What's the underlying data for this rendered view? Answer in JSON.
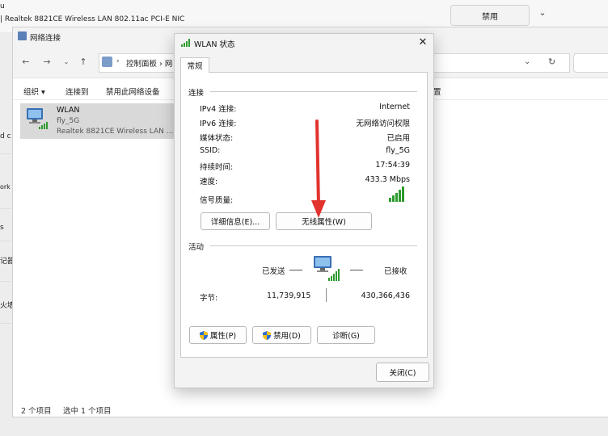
{
  "background": {
    "title_fragment": "u",
    "adapter_desc": "| Realtek 8821CE Wireless LAN 802.11ac PCI-E NIC",
    "disable_button": "禁用",
    "left_fragments": [
      "d c",
      "ork a",
      "s",
      "记器",
      "火墙"
    ]
  },
  "explorer": {
    "title": "网络连接",
    "address": {
      "separator": "›",
      "path1": "控制面板",
      "path2_fragment": "网"
    },
    "commands": {
      "organize": "组织 ▾",
      "connect_to": "连接到",
      "disable_device": "禁用此网络设备",
      "right_fragment": "置"
    },
    "item": {
      "name": "WLAN",
      "ssid": "fly_5G",
      "description": "Realtek 8821CE Wireless LAN ..."
    },
    "status": {
      "count": "2 个项目",
      "selected": "选中 1 个项目"
    }
  },
  "dialog": {
    "title": "WLAN 状态",
    "tab": "常规",
    "connection_group": "连接",
    "rows": [
      {
        "label": "IPv4 连接:",
        "value": "Internet"
      },
      {
        "label": "IPv6 连接:",
        "value": "无网络访问权限"
      },
      {
        "label": "媒体状态:",
        "value": "已启用"
      },
      {
        "label": "SSID:",
        "value": "fly_5G"
      },
      {
        "label": "持续时间:",
        "value": "17:54:39"
      },
      {
        "label": "速度:",
        "value": "433.3 Mbps"
      }
    ],
    "signal_label": "信号质量:",
    "details_button": "详细信息(E)...",
    "wireless_props_button": "无线属性(W)",
    "activity_group": "活动",
    "sent_label": "已发送",
    "received_label": "已接收",
    "bytes_label": "字节:",
    "bytes_sent": "11,739,915",
    "bytes_received": "430,366,436",
    "properties_button": "属性(P)",
    "disable_button": "禁用(D)",
    "diagnose_button": "诊断(G)",
    "close_button": "关闭(C)"
  },
  "colors": {
    "signal_green": "#2e9b2e",
    "arrow_red": "#e2332f",
    "shield_blue": "#2f6fd0",
    "shield_yellow": "#f2c21b"
  },
  "icons": {
    "signal": "signal-bars-icon",
    "computer": "network-computer-icon",
    "shield": "uac-shield-icon",
    "close": "close-icon"
  }
}
